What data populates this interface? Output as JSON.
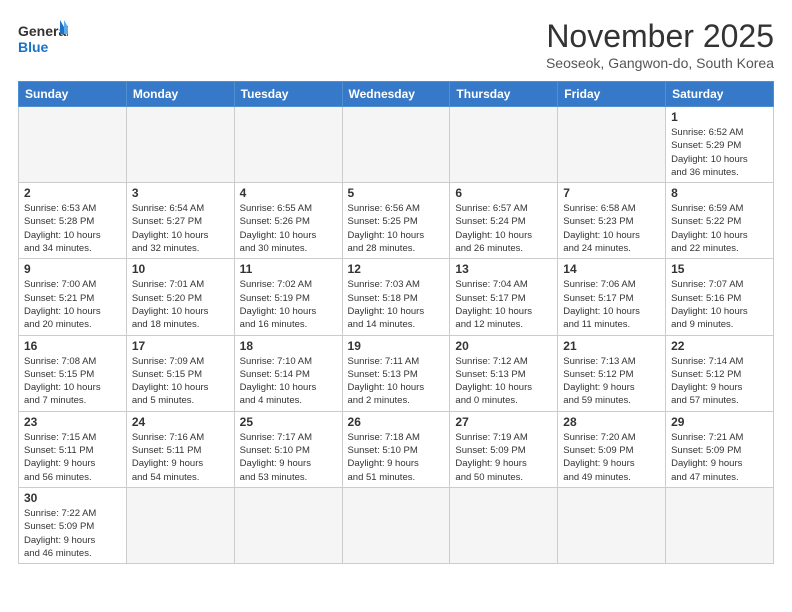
{
  "header": {
    "logo_line1": "General",
    "logo_line2": "Blue",
    "month_title": "November 2025",
    "location": "Seoseok, Gangwon-do, South Korea"
  },
  "days_of_week": [
    "Sunday",
    "Monday",
    "Tuesday",
    "Wednesday",
    "Thursday",
    "Friday",
    "Saturday"
  ],
  "weeks": [
    [
      {
        "day": "",
        "info": ""
      },
      {
        "day": "",
        "info": ""
      },
      {
        "day": "",
        "info": ""
      },
      {
        "day": "",
        "info": ""
      },
      {
        "day": "",
        "info": ""
      },
      {
        "day": "",
        "info": ""
      },
      {
        "day": "1",
        "info": "Sunrise: 6:52 AM\nSunset: 5:29 PM\nDaylight: 10 hours\nand 36 minutes."
      }
    ],
    [
      {
        "day": "2",
        "info": "Sunrise: 6:53 AM\nSunset: 5:28 PM\nDaylight: 10 hours\nand 34 minutes."
      },
      {
        "day": "3",
        "info": "Sunrise: 6:54 AM\nSunset: 5:27 PM\nDaylight: 10 hours\nand 32 minutes."
      },
      {
        "day": "4",
        "info": "Sunrise: 6:55 AM\nSunset: 5:26 PM\nDaylight: 10 hours\nand 30 minutes."
      },
      {
        "day": "5",
        "info": "Sunrise: 6:56 AM\nSunset: 5:25 PM\nDaylight: 10 hours\nand 28 minutes."
      },
      {
        "day": "6",
        "info": "Sunrise: 6:57 AM\nSunset: 5:24 PM\nDaylight: 10 hours\nand 26 minutes."
      },
      {
        "day": "7",
        "info": "Sunrise: 6:58 AM\nSunset: 5:23 PM\nDaylight: 10 hours\nand 24 minutes."
      },
      {
        "day": "8",
        "info": "Sunrise: 6:59 AM\nSunset: 5:22 PM\nDaylight: 10 hours\nand 22 minutes."
      }
    ],
    [
      {
        "day": "9",
        "info": "Sunrise: 7:00 AM\nSunset: 5:21 PM\nDaylight: 10 hours\nand 20 minutes."
      },
      {
        "day": "10",
        "info": "Sunrise: 7:01 AM\nSunset: 5:20 PM\nDaylight: 10 hours\nand 18 minutes."
      },
      {
        "day": "11",
        "info": "Sunrise: 7:02 AM\nSunset: 5:19 PM\nDaylight: 10 hours\nand 16 minutes."
      },
      {
        "day": "12",
        "info": "Sunrise: 7:03 AM\nSunset: 5:18 PM\nDaylight: 10 hours\nand 14 minutes."
      },
      {
        "day": "13",
        "info": "Sunrise: 7:04 AM\nSunset: 5:17 PM\nDaylight: 10 hours\nand 12 minutes."
      },
      {
        "day": "14",
        "info": "Sunrise: 7:06 AM\nSunset: 5:17 PM\nDaylight: 10 hours\nand 11 minutes."
      },
      {
        "day": "15",
        "info": "Sunrise: 7:07 AM\nSunset: 5:16 PM\nDaylight: 10 hours\nand 9 minutes."
      }
    ],
    [
      {
        "day": "16",
        "info": "Sunrise: 7:08 AM\nSunset: 5:15 PM\nDaylight: 10 hours\nand 7 minutes."
      },
      {
        "day": "17",
        "info": "Sunrise: 7:09 AM\nSunset: 5:15 PM\nDaylight: 10 hours\nand 5 minutes."
      },
      {
        "day": "18",
        "info": "Sunrise: 7:10 AM\nSunset: 5:14 PM\nDaylight: 10 hours\nand 4 minutes."
      },
      {
        "day": "19",
        "info": "Sunrise: 7:11 AM\nSunset: 5:13 PM\nDaylight: 10 hours\nand 2 minutes."
      },
      {
        "day": "20",
        "info": "Sunrise: 7:12 AM\nSunset: 5:13 PM\nDaylight: 10 hours\nand 0 minutes."
      },
      {
        "day": "21",
        "info": "Sunrise: 7:13 AM\nSunset: 5:12 PM\nDaylight: 9 hours\nand 59 minutes."
      },
      {
        "day": "22",
        "info": "Sunrise: 7:14 AM\nSunset: 5:12 PM\nDaylight: 9 hours\nand 57 minutes."
      }
    ],
    [
      {
        "day": "23",
        "info": "Sunrise: 7:15 AM\nSunset: 5:11 PM\nDaylight: 9 hours\nand 56 minutes."
      },
      {
        "day": "24",
        "info": "Sunrise: 7:16 AM\nSunset: 5:11 PM\nDaylight: 9 hours\nand 54 minutes."
      },
      {
        "day": "25",
        "info": "Sunrise: 7:17 AM\nSunset: 5:10 PM\nDaylight: 9 hours\nand 53 minutes."
      },
      {
        "day": "26",
        "info": "Sunrise: 7:18 AM\nSunset: 5:10 PM\nDaylight: 9 hours\nand 51 minutes."
      },
      {
        "day": "27",
        "info": "Sunrise: 7:19 AM\nSunset: 5:09 PM\nDaylight: 9 hours\nand 50 minutes."
      },
      {
        "day": "28",
        "info": "Sunrise: 7:20 AM\nSunset: 5:09 PM\nDaylight: 9 hours\nand 49 minutes."
      },
      {
        "day": "29",
        "info": "Sunrise: 7:21 AM\nSunset: 5:09 PM\nDaylight: 9 hours\nand 47 minutes."
      }
    ],
    [
      {
        "day": "30",
        "info": "Sunrise: 7:22 AM\nSunset: 5:09 PM\nDaylight: 9 hours\nand 46 minutes."
      },
      {
        "day": "",
        "info": ""
      },
      {
        "day": "",
        "info": ""
      },
      {
        "day": "",
        "info": ""
      },
      {
        "day": "",
        "info": ""
      },
      {
        "day": "",
        "info": ""
      },
      {
        "day": "",
        "info": ""
      }
    ]
  ]
}
